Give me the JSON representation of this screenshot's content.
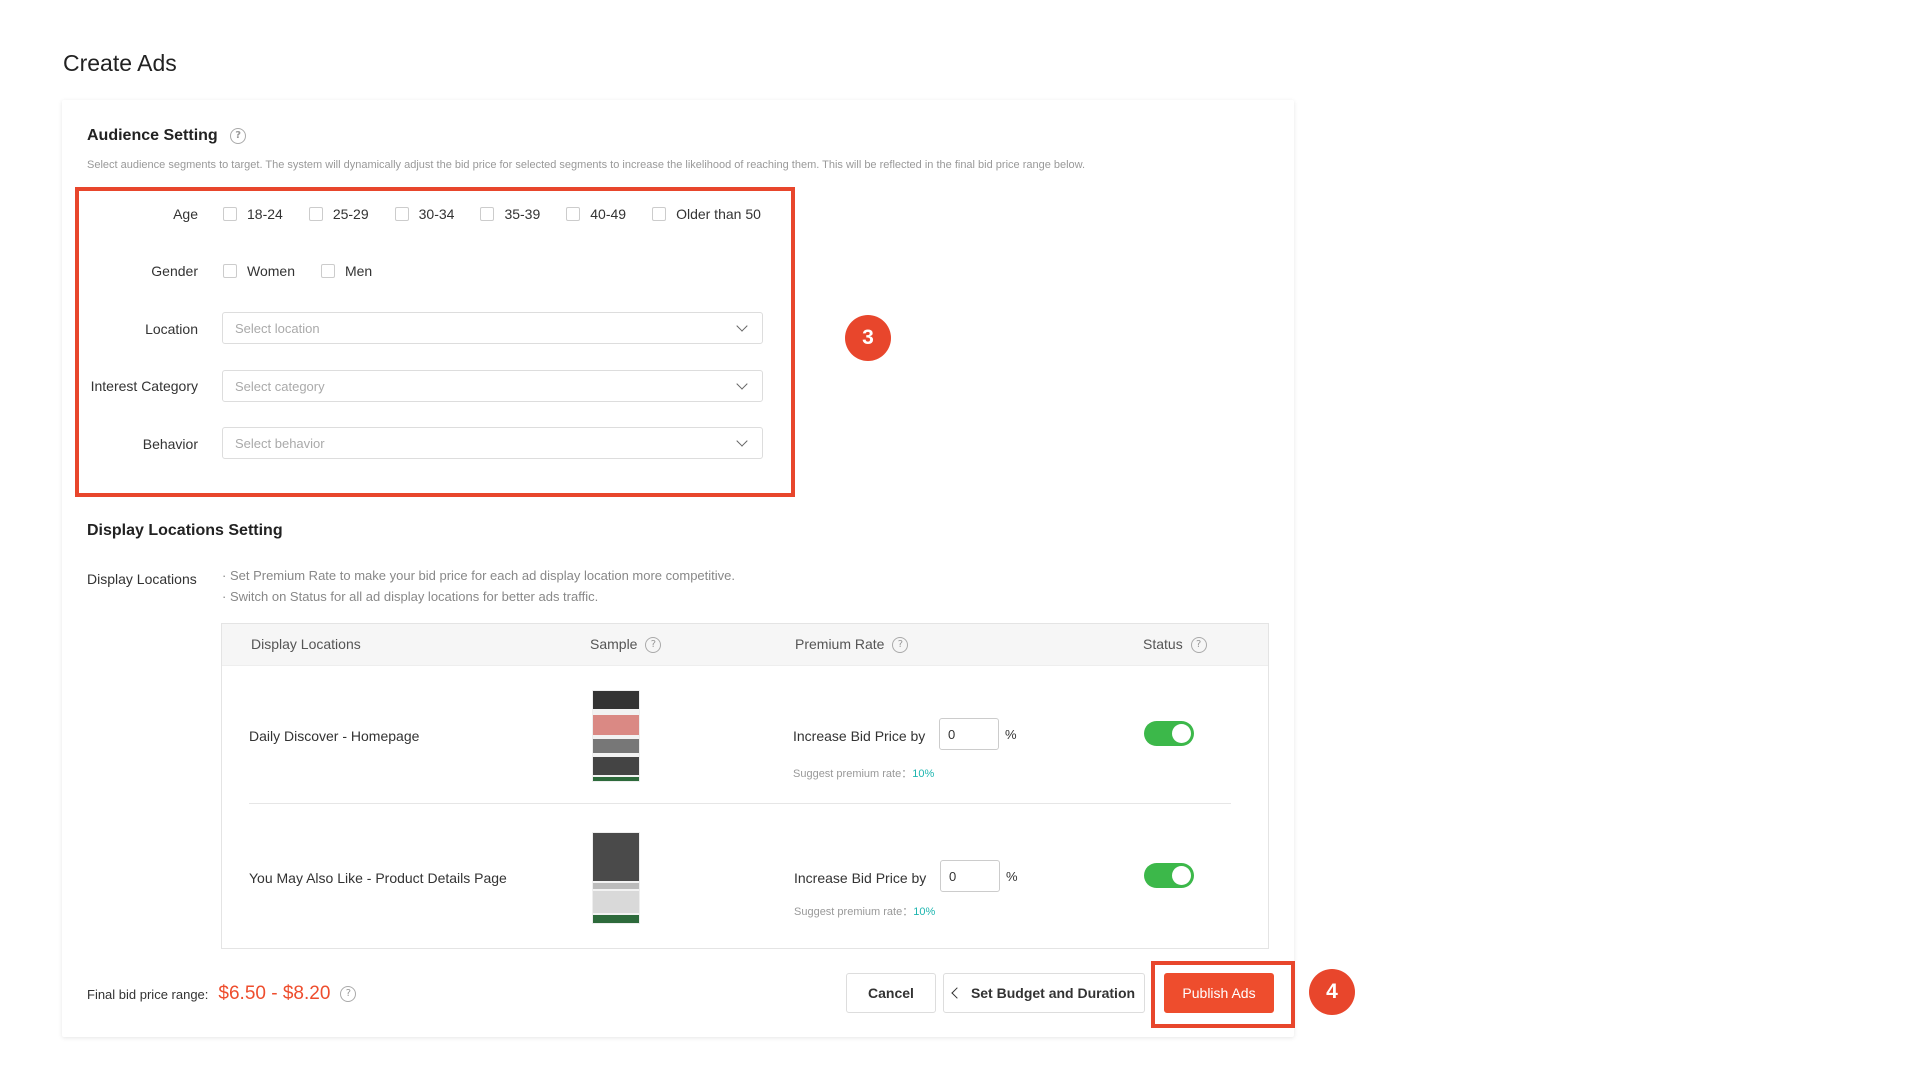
{
  "page": {
    "title": "Create Ads"
  },
  "audience": {
    "title": "Audience Setting",
    "help": "?",
    "description": "Select audience segments to target. The system will dynamically adjust the bid price for selected segments to increase the likelihood of reaching them. This will be reflected in the final bid price range below.",
    "age_label": "Age",
    "age_options": [
      "18-24",
      "25-29",
      "30-34",
      "35-39",
      "40-49",
      "Older than 50"
    ],
    "gender_label": "Gender",
    "gender_options": [
      "Women",
      "Men"
    ],
    "location_label": "Location",
    "location_placeholder": "Select location",
    "interest_label": "Interest Category",
    "interest_placeholder": "Select category",
    "behavior_label": "Behavior",
    "behavior_placeholder": "Select behavior"
  },
  "markers": {
    "step3": "3",
    "step4": "4"
  },
  "display": {
    "title": "Display Locations Setting",
    "label": "Display Locations",
    "note1": "· Set Premium Rate to make your bid price for each ad display location more competitive.",
    "note2": "· Switch on Status for all ad display locations for better ads traffic.",
    "columns": [
      "Display Locations",
      "Sample",
      "Premium Rate",
      "Status"
    ],
    "rows": [
      {
        "name": "Daily Discover - Homepage",
        "bid_label": "Increase Bid Price by",
        "bid_value": "0",
        "unit": "%",
        "suggest_label": "Suggest premium rate：",
        "suggest_rate": "10%",
        "status_on": true
      },
      {
        "name": "You May Also Like - Product Details Page",
        "bid_label": "Increase Bid Price by",
        "bid_value": "0",
        "unit": "%",
        "suggest_label": "Suggest premium rate：",
        "suggest_rate": "10%",
        "status_on": true
      }
    ]
  },
  "footer": {
    "bid_range_label": "Final bid price range:",
    "bid_range_value": "$6.50 - $8.20",
    "cancel": "Cancel",
    "back": "Set Budget and Duration",
    "publish": "Publish Ads"
  },
  "colors": {
    "accent": "#ee4d2d",
    "highlight": "#e8462c",
    "toggle_on": "#3cb84a",
    "suggest": "#1fb6b0"
  }
}
